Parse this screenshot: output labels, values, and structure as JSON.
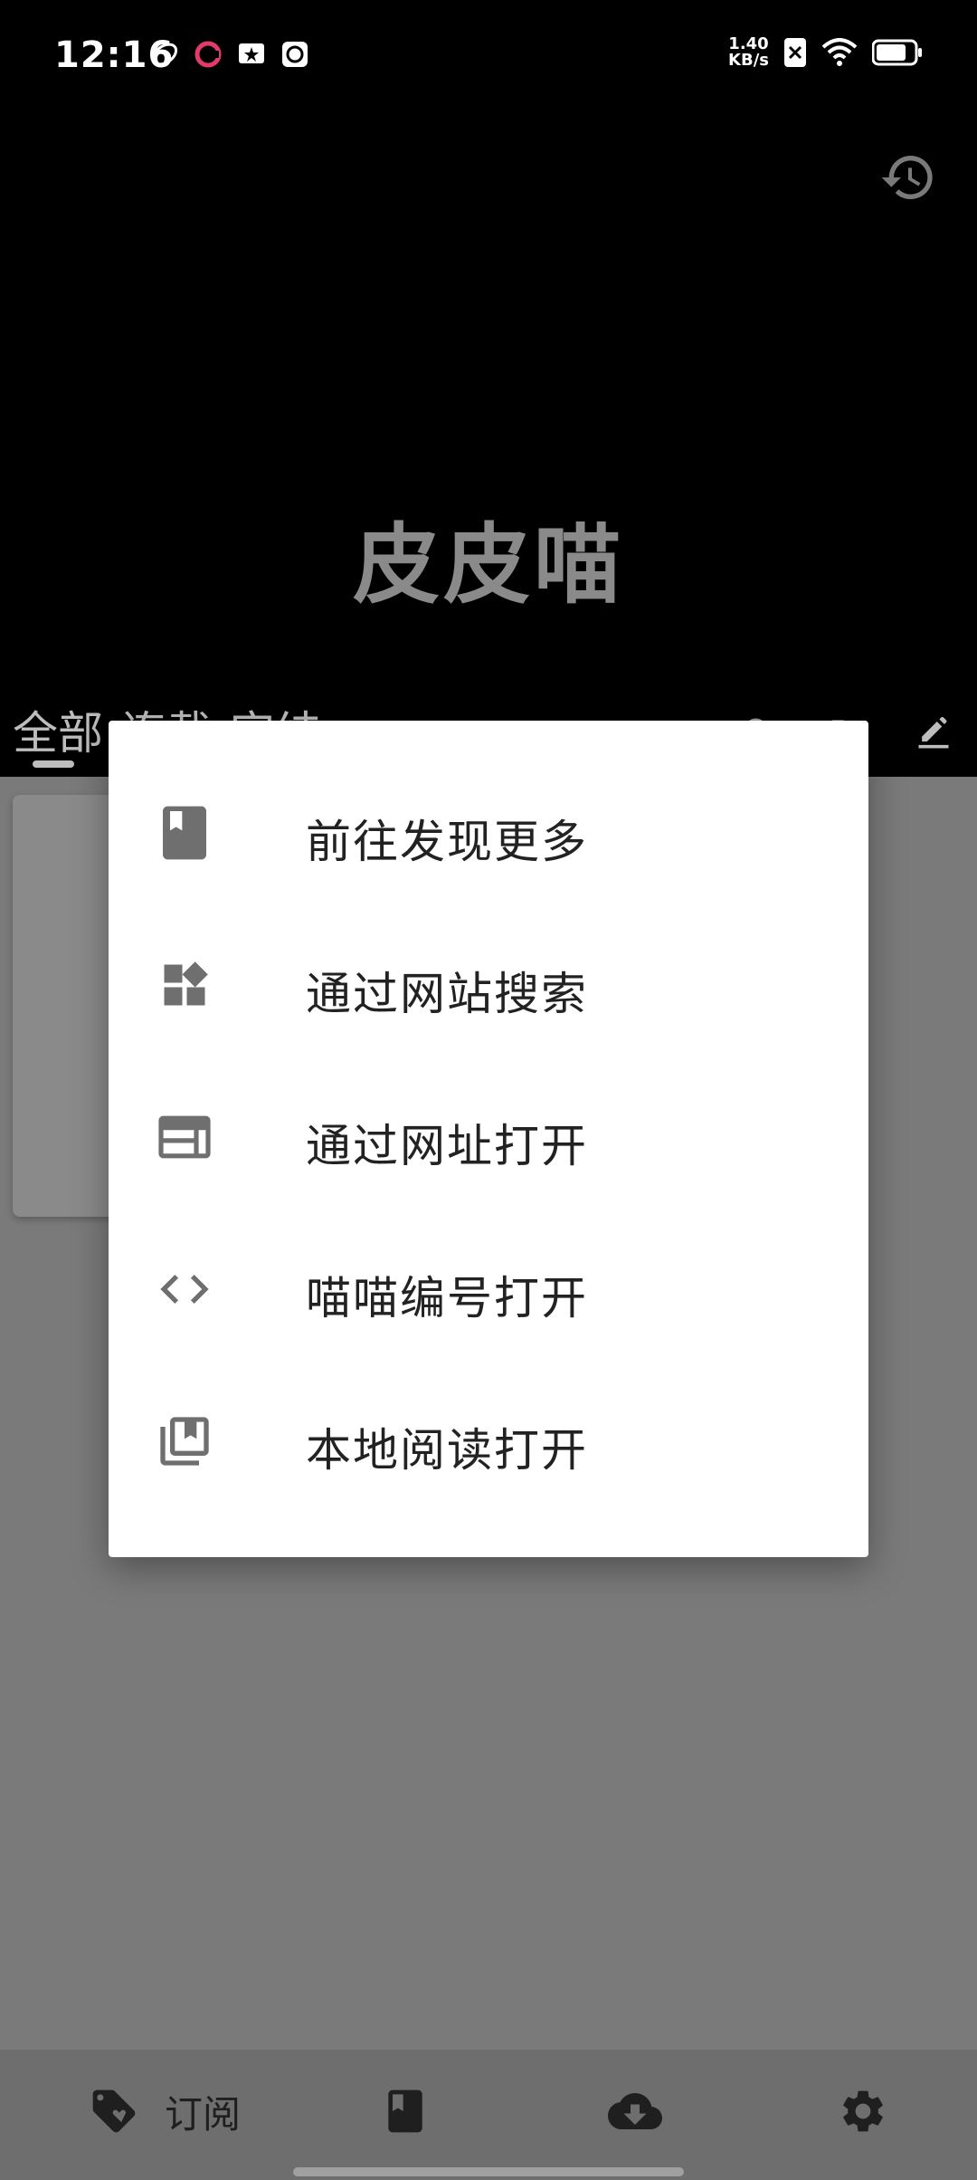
{
  "status_bar": {
    "time": "12:16",
    "net_speed_value": "1.40",
    "net_speed_unit": "KB/s"
  },
  "header": {
    "app_title": "皮皮喵"
  },
  "tabs": [
    {
      "label": "全部"
    },
    {
      "label": "连载"
    },
    {
      "label": "完结"
    }
  ],
  "dialog": {
    "items": [
      {
        "label": "前往发现更多",
        "icon": "book-icon"
      },
      {
        "label": "通过网站搜索",
        "icon": "widgets-icon"
      },
      {
        "label": "通过网址打开",
        "icon": "web-icon"
      },
      {
        "label": "喵喵编号打开",
        "icon": "code-icon"
      },
      {
        "label": "本地阅读打开",
        "icon": "library-books-icon"
      }
    ]
  },
  "bottom_nav": {
    "subscribe_label": "订阅"
  },
  "colors": {
    "icon_gray": "#6f6f6f",
    "dim_overlay": "#7a7a7a",
    "nav_icon": "#1f1f1f"
  }
}
